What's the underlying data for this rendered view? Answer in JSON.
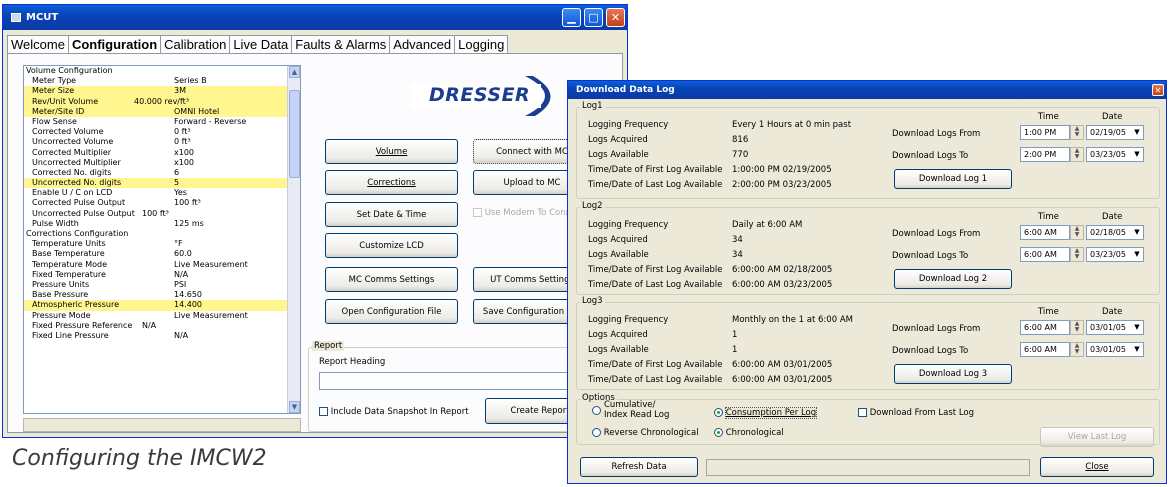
{
  "mcut": {
    "title": "MCUT",
    "tabs": [
      "Welcome",
      "Configuration",
      "Calibration",
      "Live Data",
      "Faults & Alarms",
      "Advanced",
      "Logging"
    ],
    "config": [
      {
        "k": "Volume Configuration",
        "v": "",
        "h": true
      },
      {
        "k": "Meter Type",
        "v": "Series B"
      },
      {
        "k": "Meter Size",
        "v": "3M",
        "hl": true
      },
      {
        "k": "Rev/Unit Volume",
        "v": "40.000 rev/ft³",
        "hl": true,
        "short": true
      },
      {
        "k": "Meter/Site ID",
        "v": "OMNI Hotel",
        "hl": true
      },
      {
        "k": "Flow Sense",
        "v": "Forward - Reverse"
      },
      {
        "k": "Corrected Volume",
        "v": "0 ft³"
      },
      {
        "k": "Uncorrected Volume",
        "v": "0 ft³"
      },
      {
        "k": "Corrected Multiplier",
        "v": "x100"
      },
      {
        "k": "Uncorrected Multiplier",
        "v": "x100"
      },
      {
        "k": "Corrected No. digits",
        "v": "6"
      },
      {
        "k": "Uncorrected No. digits",
        "v": "5",
        "hl": true
      },
      {
        "k": "Enable U / C on LCD",
        "v": "Yes"
      },
      {
        "k": "Corrected Pulse Output",
        "v": "100 ft³"
      },
      {
        "k": "Uncorrected Pulse Output",
        "v": "100 ft³",
        "short": true
      },
      {
        "k": "Pulse Width",
        "v": "125 ms"
      },
      {
        "k": "Corrections Configuration",
        "v": "",
        "h": true
      },
      {
        "k": "Temperature Units",
        "v": "°F"
      },
      {
        "k": "Base Temperature",
        "v": "60.0"
      },
      {
        "k": "Temperature Mode",
        "v": "Live Measurement"
      },
      {
        "k": "Fixed Temperature",
        "v": "N/A"
      },
      {
        "k": "Pressure Units",
        "v": "PSI"
      },
      {
        "k": "Base Pressure",
        "v": "14.650"
      },
      {
        "k": "Atmospheric Pressure",
        "v": "14.400",
        "hl": true
      },
      {
        "k": "Pressure Mode",
        "v": "Live Measurement"
      },
      {
        "k": "Fixed Pressure Reference",
        "v": "N/A",
        "short": true
      },
      {
        "k": "Fixed Line Pressure",
        "v": "N/A"
      }
    ],
    "logo": "DRESSER",
    "buttons": {
      "volume": "Volume",
      "corrections": "Corrections",
      "set_date": "Set Date & Time",
      "customize_lcd": "Customize LCD",
      "mc_comms": "MC Comms Settings",
      "open_cfg": "Open Configuration File",
      "connect": "Connect with MC",
      "upload": "Upload to MC",
      "ut_comms": "UT Comms Settings",
      "save_cfg": "Save Configuration File",
      "create_report": "Create Report"
    },
    "use_modem": "Use Modem To Connect",
    "report": {
      "group": "Report",
      "heading_label": "Report Heading",
      "heading_value": "",
      "snapshot": "Include Data Snapshot In Report"
    }
  },
  "caption": "Configuring the IMCW2",
  "dl": {
    "title": "Download Data Log",
    "labels": {
      "freq": "Logging Frequency",
      "acq": "Logs Acquired",
      "avail": "Logs Available",
      "first": "Time/Date of First Log Available",
      "last": "Time/Date of Last Log Available",
      "from": "Download Logs From",
      "to": "Download Logs To",
      "time": "Time",
      "date": "Date"
    },
    "logs": [
      {
        "name": "Log1",
        "freq": "Every 1 Hours at 0 min past",
        "acq": "816",
        "avail": "770",
        "first": "1:00:00 PM 02/19/2005",
        "last": "2:00:00 PM 03/23/2005",
        "from_time": "1:00 PM",
        "from_date": "02/19/05",
        "to_time": "2:00 PM",
        "to_date": "03/23/05",
        "button": "Download Log 1"
      },
      {
        "name": "Log2",
        "freq": "Daily at 6:00 AM",
        "acq": "34",
        "avail": "34",
        "first": "6:00:00 AM 02/18/2005",
        "last": "6:00:00 AM 03/23/2005",
        "from_time": "6:00 AM",
        "from_date": "02/18/05",
        "to_time": "6:00 AM",
        "to_date": "03/23/05",
        "button": "Download Log 2"
      },
      {
        "name": "Log3",
        "freq": "Monthly on the 1 at 6:00 AM",
        "acq": "1",
        "avail": "1",
        "first": "6:00:00 AM 03/01/2005",
        "last": "6:00:00 AM 03/01/2005",
        "from_time": "6:00 AM",
        "from_date": "03/01/05",
        "to_time": "6:00 AM",
        "to_date": "03/01/05",
        "button": "Download Log 3"
      }
    ],
    "options": {
      "label": "Options",
      "cumulative": "Cumulative/ Index Read Log",
      "consumption": "Consumption Per Log",
      "reverse": "Reverse Chronological",
      "chrono": "Chronological",
      "from_last": "Download From Last Log"
    },
    "view_last": "View Last Log",
    "refresh": "Refresh Data",
    "close": "Close"
  }
}
